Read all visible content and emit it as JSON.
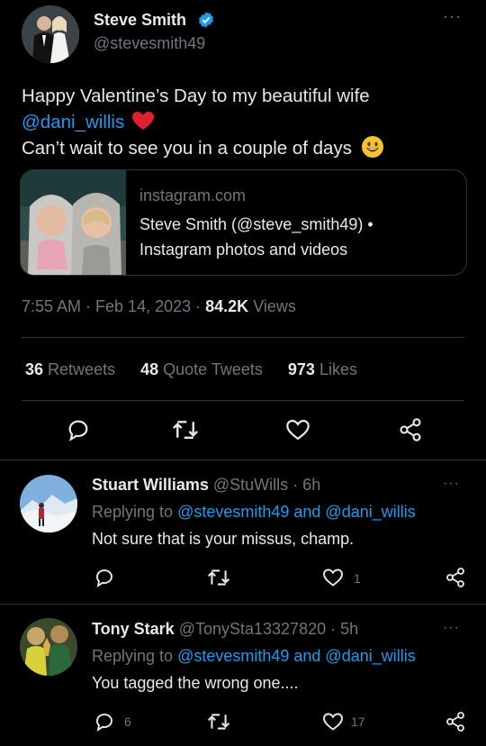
{
  "tweet": {
    "author_name": "Steve Smith",
    "author_handle": "@stevesmith49",
    "text_line1": "Happy Valentine’s Day to my beautiful wife",
    "mention": "@dani_willis",
    "text_line3": "Can’t wait to see you in a couple of days",
    "link_card": {
      "domain": "instagram.com",
      "title_line1": "Steve Smith (@steve_smith49) •",
      "title_line2": "Instagram photos and videos"
    },
    "time": "7:55 AM · Feb 14, 2023 ·",
    "views_count": "84.2K",
    "views_label": "Views",
    "stats": [
      {
        "count": "36",
        "label": "Retweets"
      },
      {
        "count": "48",
        "label": "Quote Tweets"
      },
      {
        "count": "973",
        "label": "Likes"
      }
    ],
    "more_label": "···"
  },
  "replies": [
    {
      "name": "Stuart Williams",
      "handle": "@StuWills",
      "time": "· 6h",
      "replying_prefix": "Replying to",
      "replying_targets": "@stevesmith49 and @dani_willis",
      "text": "Not sure that is your missus, champ.",
      "reply_count": "",
      "like_count": "1",
      "more_label": "···"
    },
    {
      "name": "Tony Stark",
      "handle": "@TonySta13327820",
      "time": "· 5h",
      "replying_prefix": "Replying to",
      "replying_targets": "@stevesmith49 and @dani_willis",
      "text": "You tagged the wrong one....",
      "reply_count": "6",
      "like_count": "17",
      "more_label": "···"
    }
  ],
  "colors": {
    "background": "#000000",
    "text": "#e7e9ea",
    "secondary": "#71767b",
    "accent": "#1d9bf0",
    "verified": "#1d9bf0",
    "heart": "#f91880"
  },
  "icons": [
    "verified-badge-icon",
    "heart-emoji-icon",
    "grinning-emoji-icon",
    "reply-icon",
    "retweet-icon",
    "like-icon",
    "share-icon",
    "more-icon"
  ]
}
